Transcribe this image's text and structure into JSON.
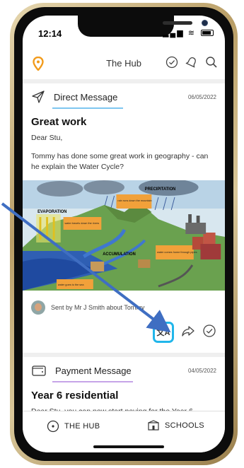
{
  "status": {
    "time": "12:14"
  },
  "appbar": {
    "title": "The Hub"
  },
  "messages": [
    {
      "type": "Direct Message",
      "date": "06/05/2022",
      "title": "Great work",
      "greeting": "Dear Stu,",
      "body": "Tommy has done some great work in geography - can he explain the Water Cycle?",
      "artwork_labels": {
        "precipitation": "PRECIPITATION",
        "evaporation": "EVAPORATION",
        "accumulation": "ACCUMULATION",
        "rain_note": "rain runs down the mountain",
        "water_note": "water travels down the rivers",
        "town_note": "water comes home through pipes",
        "sea_note": "water goes to the sea"
      },
      "sender": "Sent by Mr J Smith about Tommy"
    },
    {
      "type": "Payment Message",
      "date": "04/05/2022",
      "title": "Year 6 residential",
      "body": "Dear Stu, you can now start paying for the Year 6"
    }
  ],
  "nav": {
    "hub_label": "THE HUB",
    "schools_label": "SCHOOLS"
  },
  "colors": {
    "accent_blue": "#21b6ea",
    "pointer_blue": "#3f6ec2",
    "pin_orange": "#f29b1b"
  }
}
